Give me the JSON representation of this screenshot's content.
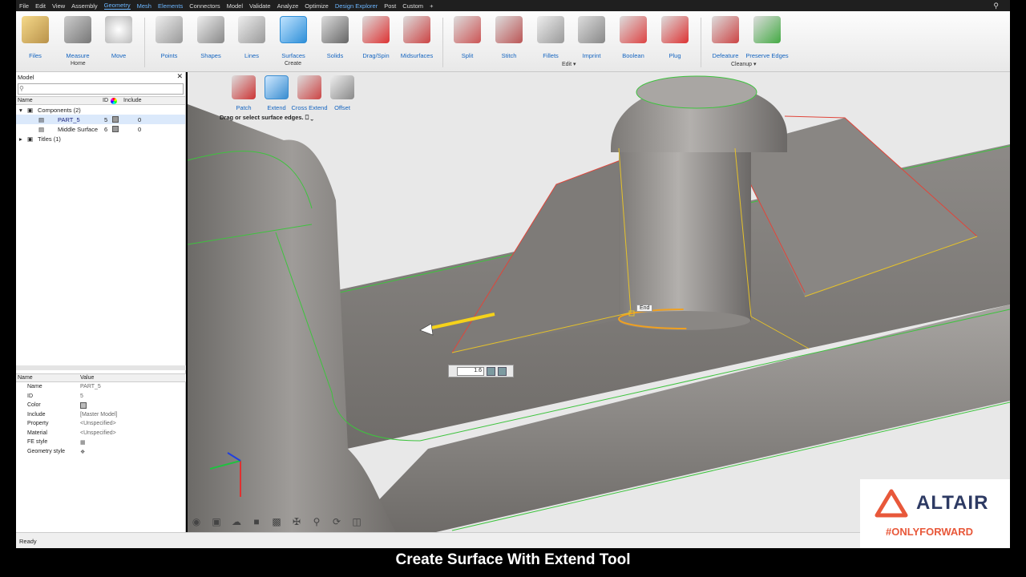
{
  "menu": [
    "File",
    "Edit",
    "View",
    "Assembly",
    "Geometry",
    "Mesh",
    "Elements",
    "Connectors",
    "Model",
    "Validate",
    "Analyze",
    "Optimize",
    "Design Explorer",
    "Post",
    "Custom",
    "+"
  ],
  "ribbon": {
    "tools": [
      "Files",
      "Measure",
      "Move",
      "Points",
      "Shapes",
      "Lines",
      "Surfaces",
      "Solids",
      "Drag/Spin",
      "Midsurfaces",
      "Split",
      "Stitch",
      "Fillets",
      "Imprint",
      "Boolean",
      "Plug",
      "Defeature",
      "Preserve Edges"
    ],
    "groups": {
      "home": "Home",
      "create": "Create",
      "edit": "Edit",
      "cleanup": "Cleanup"
    }
  },
  "model_panel": {
    "title": "Model",
    "headers": {
      "name": "Name",
      "id": "ID",
      "include": "Include"
    },
    "tree": {
      "components": "Components (2)",
      "part": {
        "name": "PART_5",
        "id": "5",
        "include": "0"
      },
      "middle": {
        "name": "Middle Surface",
        "id": "6",
        "include": "0"
      },
      "titles": "Titles (1)"
    }
  },
  "properties": {
    "headers": {
      "name": "Name",
      "value": "Value"
    },
    "rows": [
      {
        "k": "Name",
        "v": "PART_5"
      },
      {
        "k": "ID",
        "v": "5"
      },
      {
        "k": "Color",
        "v": ""
      },
      {
        "k": "Include",
        "v": "[Master Model]"
      },
      {
        "k": "Property",
        "v": "<Unspecified>"
      },
      {
        "k": "Material",
        "v": "<Unspecified>"
      },
      {
        "k": "FE style",
        "v": ""
      },
      {
        "k": "Geometry style",
        "v": ""
      }
    ]
  },
  "subtools": [
    "Patch",
    "Extend",
    "Cross Extend",
    "Offset"
  ],
  "hint": "Drag or select surface edges.",
  "end_label": "End",
  "extend_value": "1.6",
  "status": "Ready",
  "logo": {
    "name": "ALTAIR",
    "tagline": "#ONLYFORWARD"
  },
  "caption": "Create Surface With Extend Tool",
  "colors": {
    "accent": "#1565c0",
    "edge_green": "#3ec33e",
    "edge_yellow": "#e6c22a",
    "edge_red": "#e0453a",
    "brand_orange": "#e8583a"
  }
}
